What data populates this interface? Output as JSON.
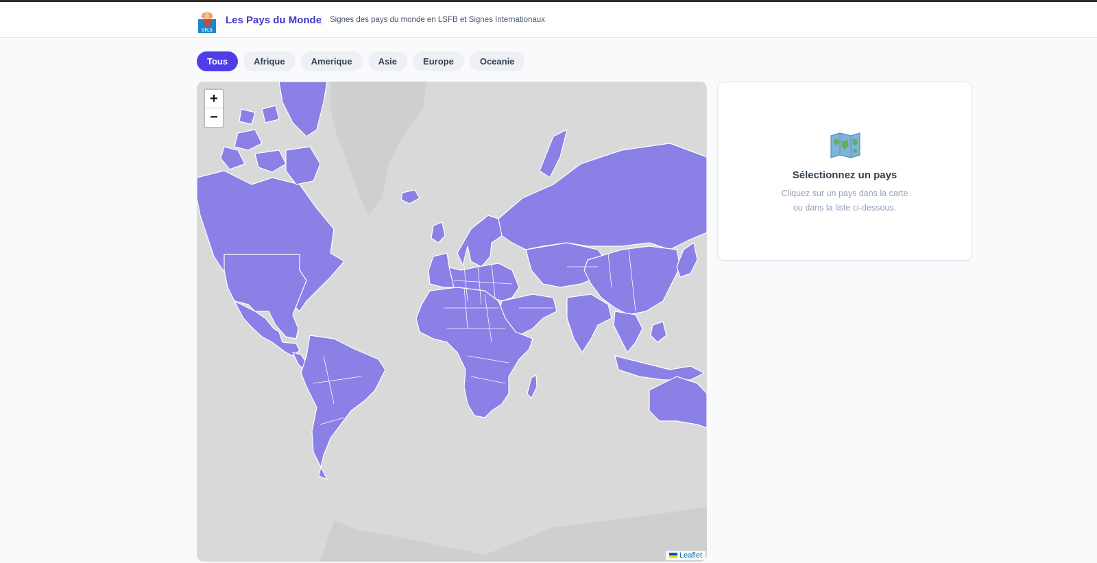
{
  "header": {
    "title": "Les Pays du Monde",
    "tagline": "Signes des pays du monde en LSFB et Signes Internationaux",
    "logo_text": "CFLS"
  },
  "filters": {
    "items": [
      {
        "label": "Tous",
        "active": true
      },
      {
        "label": "Afrique",
        "active": false
      },
      {
        "label": "Amerique",
        "active": false
      },
      {
        "label": "Asie",
        "active": false
      },
      {
        "label": "Europe",
        "active": false
      },
      {
        "label": "Oceanie",
        "active": false
      }
    ]
  },
  "map": {
    "zoom_in": "+",
    "zoom_out": "−",
    "attribution": "Leaflet",
    "country_color": "#8a80e6",
    "ocean_color": "#d9d9d9"
  },
  "panel": {
    "icon": "world-map-icon",
    "title": "Sélectionnez un pays",
    "hint_line1": "Cliquez sur un pays dans la carte",
    "hint_line2": "ou dans la liste ci-dessous."
  },
  "colors": {
    "accent": "#4f3de8",
    "brand": "#4338ca"
  }
}
